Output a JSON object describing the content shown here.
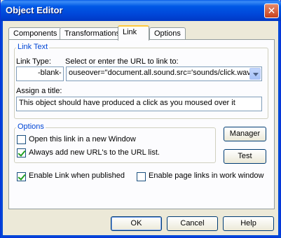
{
  "window": {
    "title": "Object Editor",
    "close_icon": "close-icon"
  },
  "tabs": [
    {
      "label": "Components",
      "active": false
    },
    {
      "label": "Transformations",
      "active": false
    },
    {
      "label": "Link",
      "active": true
    },
    {
      "label": "Options",
      "active": false
    }
  ],
  "link_text": {
    "group_label": "Link Text",
    "link_type_label": "Link Type:",
    "link_type_value": "-blank-",
    "url_label": "Select or enter the URL to link to:",
    "url_value": "ouseover=\"document.all.sound.src='sounds/click.wav'",
    "assign_title_label": "Assign a title:",
    "title_value": "This object should have produced a click as you moused over it"
  },
  "options": {
    "group_label": "Options",
    "new_window_label": "Open this link in a new Window",
    "new_window_checked": false,
    "add_urls_label": "Always add new URL's to the URL list.",
    "add_urls_checked": true,
    "manager_label": "Manager",
    "test_label": "Test"
  },
  "enable_link_label": "Enable Link when published",
  "enable_link_checked": true,
  "enable_page_links_label": "Enable page links in work window",
  "enable_page_links_checked": false,
  "buttons": {
    "ok": "OK",
    "cancel": "Cancel",
    "help": "Help"
  }
}
